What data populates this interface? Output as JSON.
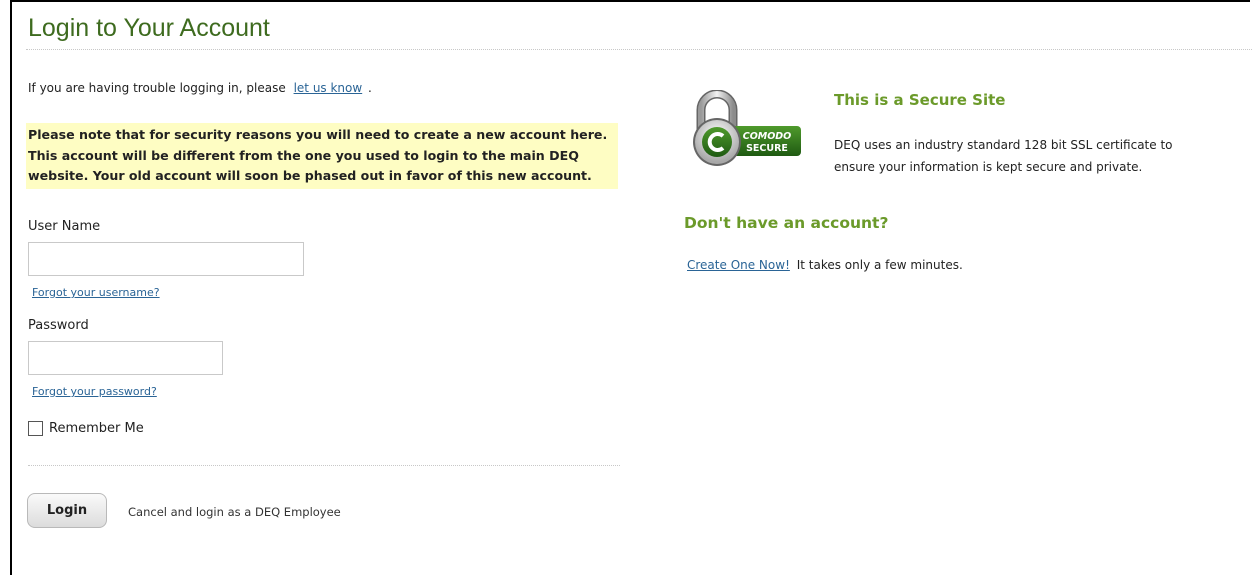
{
  "page": {
    "title": "Login to Your Account",
    "accent_color": "#6b9a2a",
    "title_color": "#3e6b1f",
    "link_color": "#2a6496",
    "notice_background": "#fefdc3"
  },
  "help": {
    "prefix": "If you are having trouble logging in, please",
    "link_label": "let us know",
    "suffix": "."
  },
  "notice": {
    "text": "Please note that for security reasons you will need to create a new account here. This account will be different from the one you used to login to the main DEQ website. Your old account will soon be phased out in favor of this new account."
  },
  "form": {
    "username_label": "User Name",
    "username_value": "",
    "forgot_username": "Forgot your username?",
    "password_label": "Password",
    "password_value": "",
    "forgot_password": "Forgot your password?",
    "remember_label": "Remember Me",
    "remember_checked": false,
    "login_button": "Login",
    "cancel_link": "Cancel and login as a DEQ Employee"
  },
  "secure": {
    "badge_icon": "comodo-secure-lock-icon",
    "badge_line1": "COMODO",
    "badge_line2": "SECURE",
    "heading": "This is a Secure Site",
    "description": "DEQ uses an industry standard 128 bit SSL certificate to ensure your information is kept secure and private."
  },
  "account": {
    "heading": "Don't have an account?",
    "create_link": "Create One Now!",
    "create_text": "It takes only a few minutes."
  }
}
